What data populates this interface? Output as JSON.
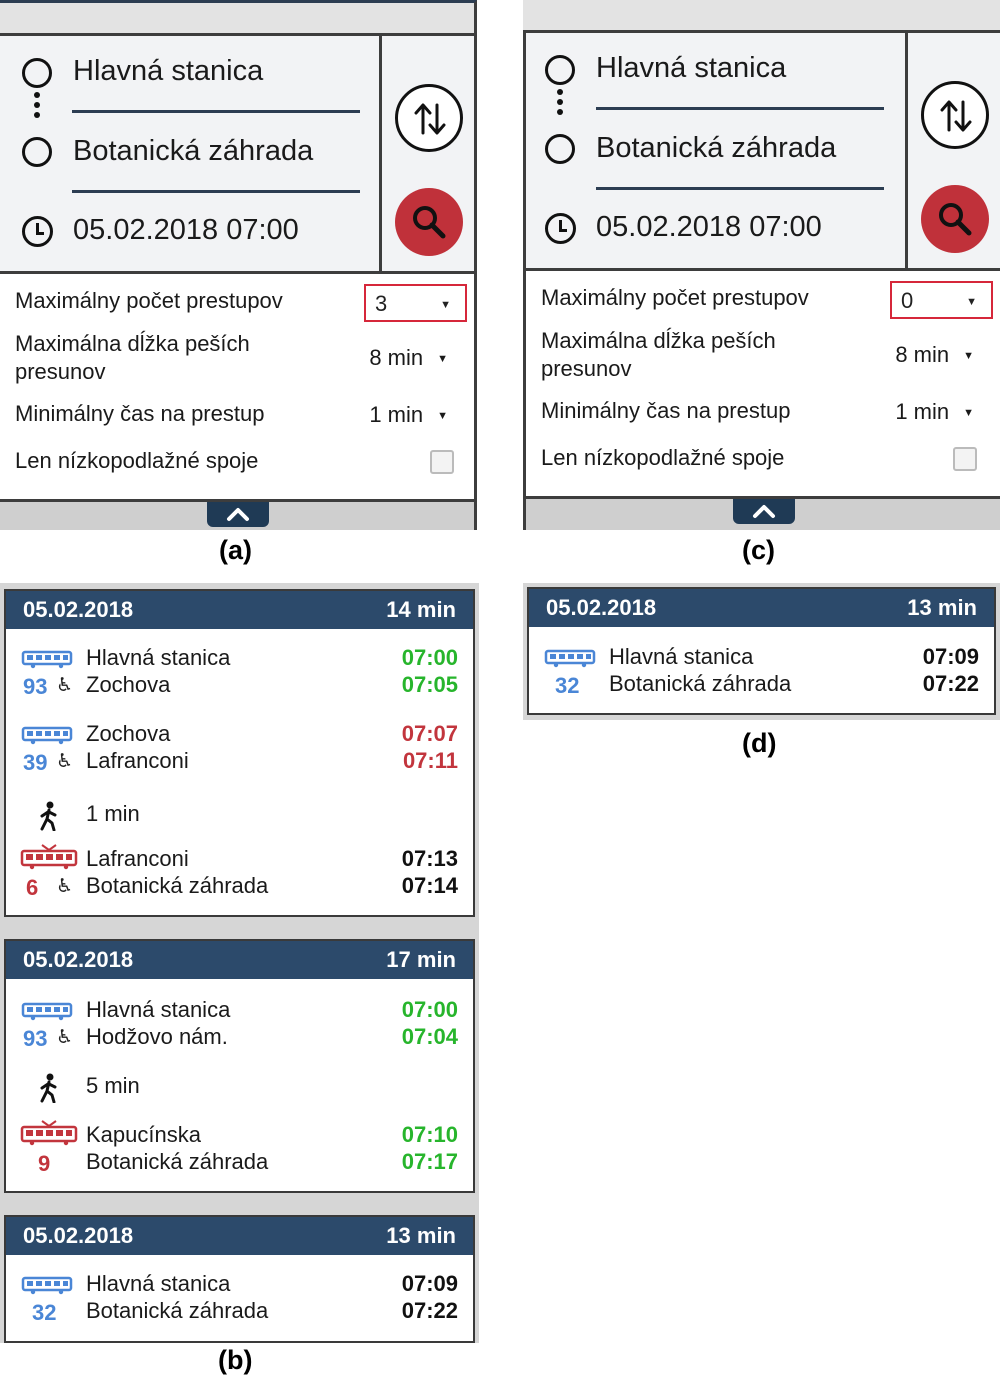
{
  "colors": {
    "header_bg": "#2c4a6b",
    "on_time": "#27b52c",
    "delayed": "#c2353d",
    "bus_blue": "#4a86d6",
    "tram_red": "#c2353d",
    "search_red": "#c0313a"
  },
  "figure_labels": {
    "a": "(a)",
    "b": "(b)",
    "c": "(c)",
    "d": "(d)"
  },
  "panel_a": {
    "from": "Hlavná stanica",
    "to": "Botanická záhrada",
    "datetime": "05.02.2018 07:00",
    "options": {
      "max_transfers_label": "Maximálny počet prestupov",
      "max_transfers_value": "3",
      "max_walk_label": "Maximálna dĺžka peších presunov",
      "max_walk_value": "8 min",
      "min_transfer_label": "Minimálny čas na prestup",
      "min_transfer_value": "1 min",
      "low_floor_label": "Len nízkopodlažné spoje"
    }
  },
  "panel_c": {
    "from": "Hlavná stanica",
    "to": "Botanická záhrada",
    "datetime": "05.02.2018 07:00",
    "options": {
      "max_transfers_label": "Maximálny počet prestupov",
      "max_transfers_value": "0",
      "max_walk_label": "Maximálna dĺžka peších presunov",
      "max_walk_value": "8 min",
      "min_transfer_label": "Minimálny čas na prestup",
      "min_transfer_value": "1 min",
      "low_floor_label": "Len nízkopodlažné spoje"
    }
  },
  "results_b": [
    {
      "date": "05.02.2018",
      "duration": "14 min",
      "legs": [
        {
          "type": "bus",
          "line": "93",
          "wheelchair": "♿",
          "from": "Hlavná stanica",
          "to": "Zochova",
          "dep": "07:00",
          "arr": "07:05",
          "status": "on_time"
        },
        {
          "type": "bus",
          "line": "39",
          "wheelchair": "♿",
          "from": "Zochova",
          "to": "Lafranconi",
          "dep": "07:07",
          "arr": "07:11",
          "status": "delayed"
        },
        {
          "type": "walk",
          "text": "1 min"
        },
        {
          "type": "tram",
          "line": "6",
          "wheelchair": "♿",
          "from": "Lafranconi",
          "to": "Botanická záhrada",
          "dep": "07:13",
          "arr": "07:14",
          "status": "scheduled"
        }
      ]
    },
    {
      "date": "05.02.2018",
      "duration": "17 min",
      "legs": [
        {
          "type": "bus",
          "line": "93",
          "wheelchair": "♿",
          "from": "Hlavná stanica",
          "to": "Hodžovo nám.",
          "dep": "07:00",
          "arr": "07:04",
          "status": "on_time"
        },
        {
          "type": "walk",
          "text": "5 min"
        },
        {
          "type": "tram",
          "line": "9",
          "wheelchair": "",
          "from": "Kapucínska",
          "to": "Botanická záhrada",
          "dep": "07:10",
          "arr": "07:17",
          "status": "on_time"
        }
      ]
    },
    {
      "date": "05.02.2018",
      "duration": "13 min",
      "legs": [
        {
          "type": "bus",
          "line": "32",
          "wheelchair": "",
          "from": "Hlavná stanica",
          "to": "Botanická záhrada",
          "dep": "07:09",
          "arr": "07:22",
          "status": "scheduled"
        }
      ]
    }
  ],
  "results_d": [
    {
      "date": "05.02.2018",
      "duration": "13 min",
      "legs": [
        {
          "type": "bus",
          "line": "32",
          "wheelchair": "",
          "from": "Hlavná stanica",
          "to": "Botanická záhrada",
          "dep": "07:09",
          "arr": "07:22",
          "status": "scheduled"
        }
      ]
    }
  ]
}
